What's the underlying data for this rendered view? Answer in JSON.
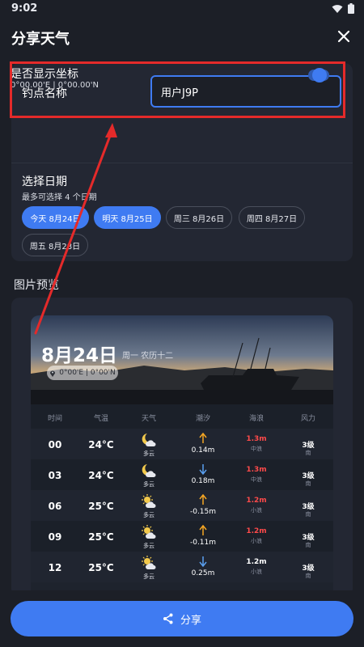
{
  "status": {
    "time": "9:02"
  },
  "header": {
    "title": "分享天气"
  },
  "form": {
    "name_label": "钓点名称",
    "name_value": "用户J9P",
    "coord_label": "是否显示坐标",
    "coord_value": "0°00.00'E | 0°00.00'N",
    "coord_enabled": true,
    "date_label": "选择日期",
    "date_hint": "最多可选择 4 个日期",
    "dates": [
      {
        "label": "今天  8月24日",
        "selected": true
      },
      {
        "label": "明天  8月25日",
        "selected": true
      },
      {
        "label": "周三  8月26日",
        "selected": false
      },
      {
        "label": "周四  8月27日",
        "selected": false
      },
      {
        "label": "周五  8月28日",
        "selected": false
      }
    ]
  },
  "preview": {
    "label": "图片预览",
    "hero_date": "8月24日",
    "hero_sub": "周一  农历十二",
    "hero_coord": "0°00'E | 0°00'N",
    "columns": [
      "时间",
      "气温",
      "天气",
      "潮汐",
      "海浪",
      "风力"
    ],
    "rows": [
      {
        "time": "00",
        "temp": "24°C",
        "wx": "多云",
        "wx_icon": "moon-cloud",
        "tide": "0.14m",
        "tide_dir": "up",
        "sea": "1.3m",
        "sea_sub": "中浪",
        "sea_color": "#ff4a4a",
        "wind": "3级",
        "wind_sub": "南"
      },
      {
        "time": "03",
        "temp": "24°C",
        "wx": "多云",
        "wx_icon": "moon-cloud",
        "tide": "0.18m",
        "tide_dir": "down",
        "sea": "1.3m",
        "sea_sub": "中浪",
        "sea_color": "#ff4a4a",
        "wind": "3级",
        "wind_sub": "南"
      },
      {
        "time": "06",
        "temp": "25°C",
        "wx": "多云",
        "wx_icon": "sun-cloud",
        "tide": "-0.15m",
        "tide_dir": "up",
        "sea": "1.2m",
        "sea_sub": "小浪",
        "sea_color": "#ff4a4a",
        "wind": "3级",
        "wind_sub": "南"
      },
      {
        "time": "09",
        "temp": "25°C",
        "wx": "多云",
        "wx_icon": "sun-cloud",
        "tide": "-0.11m",
        "tide_dir": "up",
        "sea": "1.2m",
        "sea_sub": "小浪",
        "sea_color": "#ff4a4a",
        "wind": "3级",
        "wind_sub": "南"
      },
      {
        "time": "12",
        "temp": "25°C",
        "wx": "多云",
        "wx_icon": "sun-cloud",
        "tide": "0.25m",
        "tide_dir": "down",
        "sea": "1.2m",
        "sea_sub": "小浪",
        "sea_color": "#ffffff",
        "wind": "3级",
        "wind_sub": "南"
      }
    ]
  },
  "share": {
    "label": "分享"
  },
  "colors": {
    "accent": "#3f7bf2",
    "highlight": "#e42a2a",
    "tide_up": "#f5a623",
    "tide_down": "#5aa0f0"
  }
}
